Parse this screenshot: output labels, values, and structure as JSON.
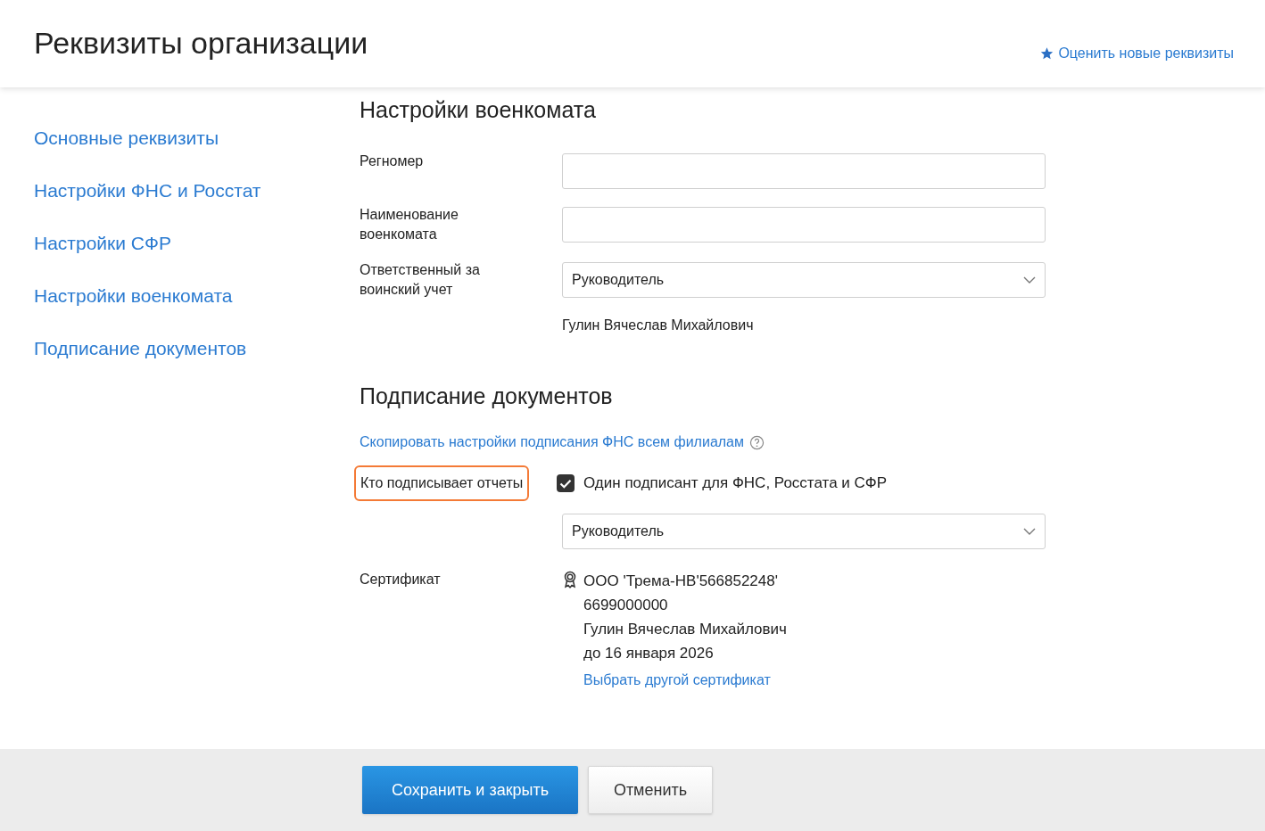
{
  "header": {
    "title": "Реквизиты организации",
    "rate_link": "Оценить новые реквизиты"
  },
  "sidebar": {
    "items": [
      {
        "label": "Основные реквизиты"
      },
      {
        "label": "Настройки ФНС и Росстат"
      },
      {
        "label": "Настройки СФР"
      },
      {
        "label": "Настройки военкомата"
      },
      {
        "label": "Подписание документов"
      }
    ]
  },
  "military": {
    "heading": "Настройки военкомата",
    "fields": [
      {
        "kind": "input",
        "label": "Регномер"
      },
      {
        "kind": "input",
        "label": "Наименование военкомата"
      },
      {
        "kind": "select",
        "label": "Ответственный за воинский учет",
        "value": "Руководитель",
        "note": "Гулин Вячеслав Михайлович"
      }
    ]
  },
  "signing": {
    "heading": "Подписание документов",
    "copy_link": "Скопировать настройки подписания ФНС всем филиалам",
    "signer_label": "Кто подписывает отчеты",
    "signer_label_highlighted": true,
    "single_signer": {
      "label": "Один подписант для ФНС, Росстата и СФР",
      "checked": true
    },
    "signer_select": "Руководитель",
    "certificate": {
      "label": "Сертификат",
      "lines": [
        "ООО 'Трема-НВ'566852248'",
        "6699000000",
        "Гулин Вячеслав Михайлович",
        "до 16 января 2026"
      ],
      "change_link": "Выбрать другой сертификат"
    }
  },
  "footer": {
    "buttons": [
      {
        "kind": "primary",
        "label": "Сохранить и закрыть"
      },
      {
        "kind": "secondary",
        "label": "Отменить"
      }
    ]
  }
}
